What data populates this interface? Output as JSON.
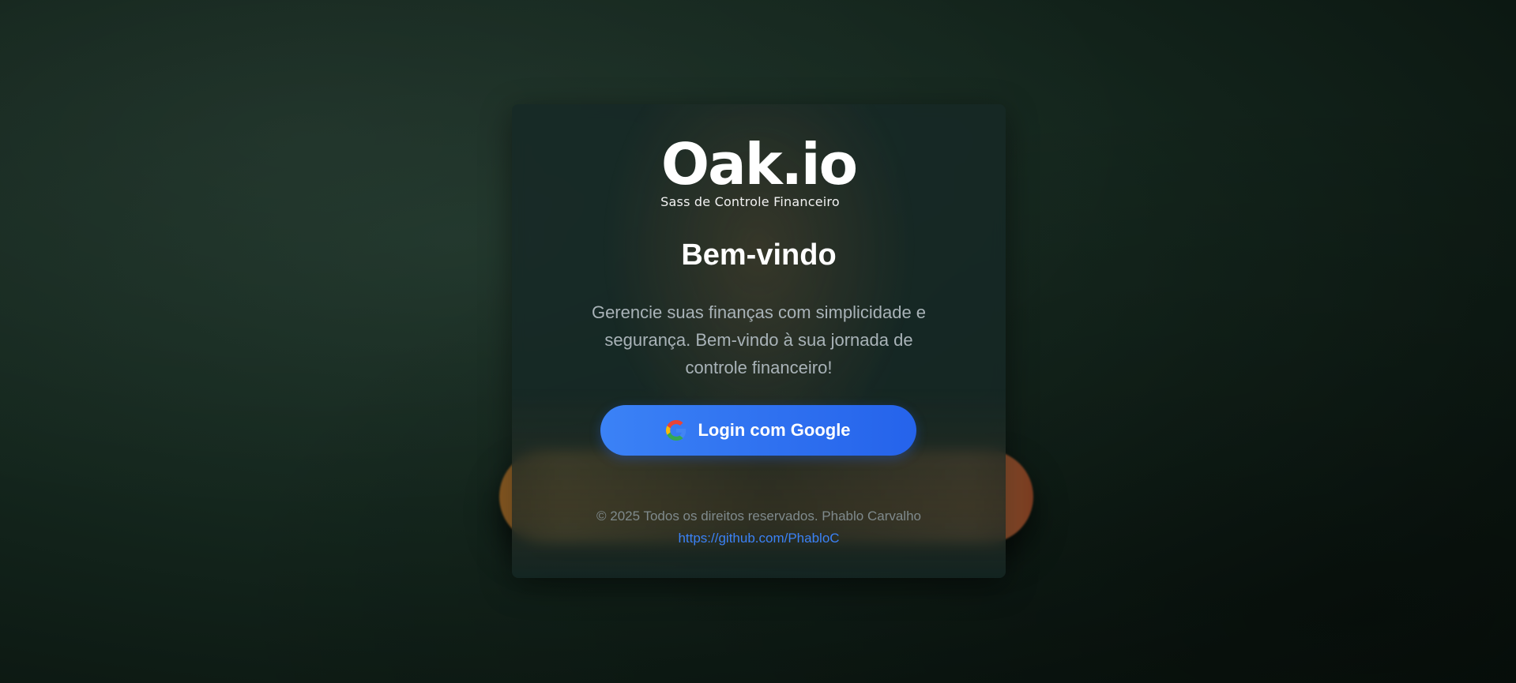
{
  "logo": {
    "name": "Oak.io",
    "tagline": "Sass de Controle Financeiro"
  },
  "welcome": {
    "title": "Bem-vindo",
    "description": "Gerencie suas finanças com simplicidade e segurança. Bem-vindo à sua jornada de controle financeiro!"
  },
  "login": {
    "button_label": "Login com Google",
    "icon": "google-icon"
  },
  "footer": {
    "copyright": "© 2025 Todos os direitos reservados. Phablo Carvalho",
    "link_text": "https://github.com/PhabloC"
  },
  "colors": {
    "accent": "#3b82f6",
    "accent_dark": "#2563eb",
    "background": "#14261d",
    "card": "#162826"
  }
}
